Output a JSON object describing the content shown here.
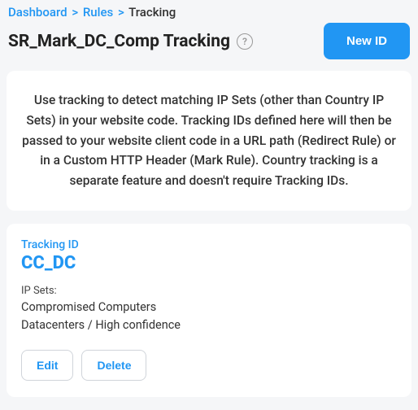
{
  "breadcrumb": {
    "items": [
      {
        "label": "Dashboard",
        "link": true
      },
      {
        "label": "Rules",
        "link": true
      },
      {
        "label": "Tracking",
        "link": false
      }
    ],
    "separator": ">"
  },
  "header": {
    "title": "SR_Mark_DC_Comp Tracking",
    "help_symbol": "?",
    "new_button": "New ID"
  },
  "description": "Use tracking to detect matching IP Sets (other than Country IP Sets) in your website code. Tracking IDs defined here will then be passed to your website client code in a URL path (Redirect Rule) or in a Custom HTTP Header (Mark Rule). Country tracking is a separate feature and doesn't require Tracking IDs.",
  "tracking_card": {
    "label": "Tracking ID",
    "value": "CC_DC",
    "ipsets_label": "IP Sets:",
    "ipsets": [
      "Compromised Computers",
      "Datacenters / High confidence"
    ],
    "edit_label": "Edit",
    "delete_label": "Delete"
  }
}
